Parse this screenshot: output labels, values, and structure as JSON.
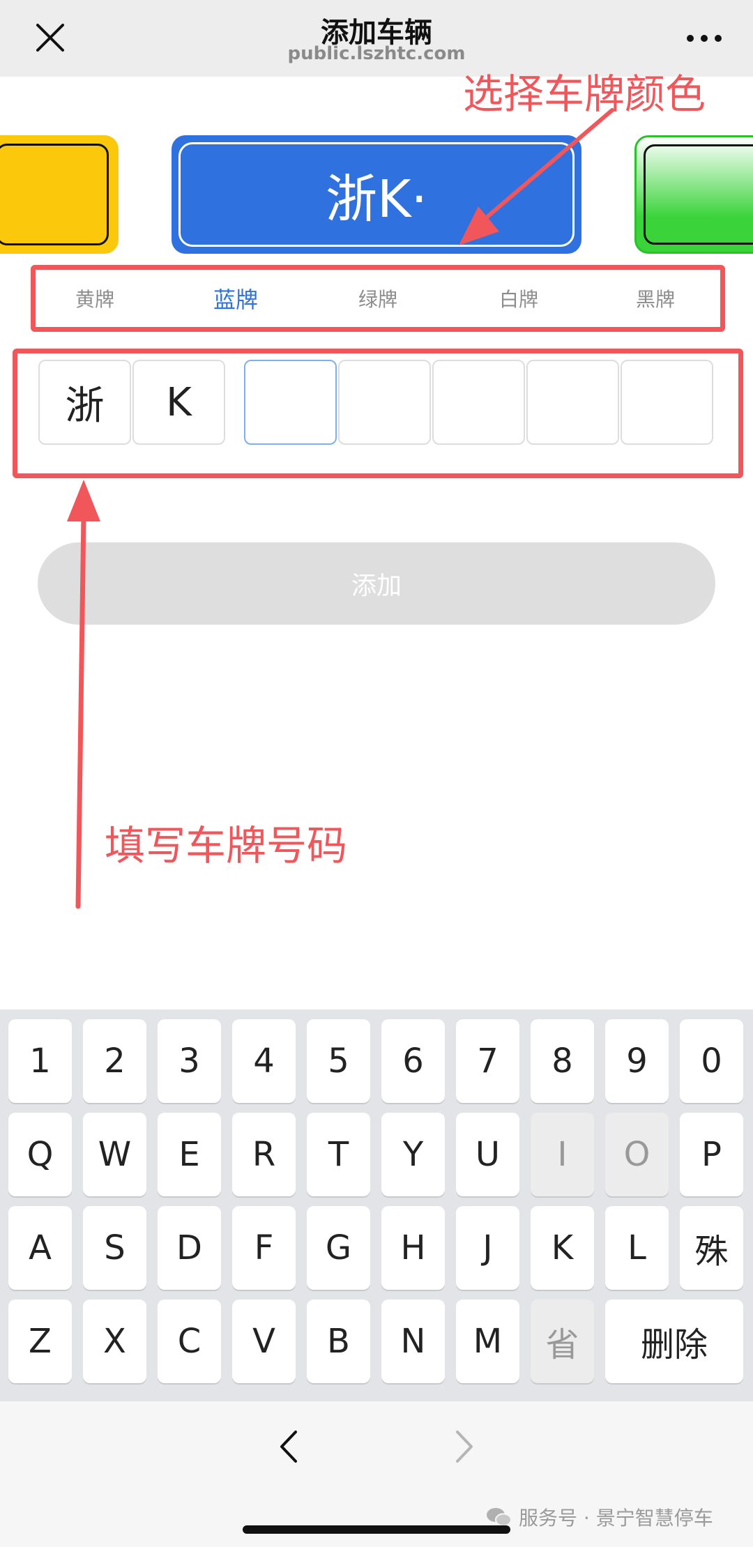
{
  "header": {
    "title": "添加车辆",
    "subtitle": "public.lszhtc.com",
    "close_icon": "close-icon",
    "more_icon": "more-dots-icon"
  },
  "plate_preview": {
    "text": "浙K·",
    "selected_color": "#2f71de",
    "colors": {
      "yellow": "#fbc80c",
      "blue": "#2f71de",
      "green": "#3ad43a"
    }
  },
  "tabs": [
    {
      "label": "黄牌",
      "active": false
    },
    {
      "label": "蓝牌",
      "active": true
    },
    {
      "label": "绿牌",
      "active": false
    },
    {
      "label": "白牌",
      "active": false
    },
    {
      "label": "黑牌",
      "active": false
    }
  ],
  "plate_input": {
    "cells": [
      "浙",
      "K",
      "",
      "",
      "",
      "",
      ""
    ],
    "focused_index": 2
  },
  "add_button": {
    "label": "添加"
  },
  "annotations": {
    "select_color": "选择车牌颜色",
    "fill_number": "填写车牌号码",
    "color": "#f0565a"
  },
  "keyboard": {
    "rows": [
      [
        "1",
        "2",
        "3",
        "4",
        "5",
        "6",
        "7",
        "8",
        "9",
        "0"
      ],
      [
        "Q",
        "W",
        "E",
        "R",
        "T",
        "Y",
        "U",
        "I",
        "O",
        "P"
      ],
      [
        "A",
        "S",
        "D",
        "F",
        "G",
        "H",
        "J",
        "K",
        "L",
        "殊"
      ],
      [
        "Z",
        "X",
        "C",
        "V",
        "B",
        "N",
        "M",
        "省",
        "删除"
      ]
    ],
    "disabled": [
      "I",
      "O",
      "省"
    ]
  },
  "bottom_nav": {
    "back_icon": "chevron-left-icon",
    "forward_icon": "chevron-right-icon",
    "watermark": "服务号 · 景宁智慧停车",
    "watermark_icon": "wechat-icon"
  }
}
